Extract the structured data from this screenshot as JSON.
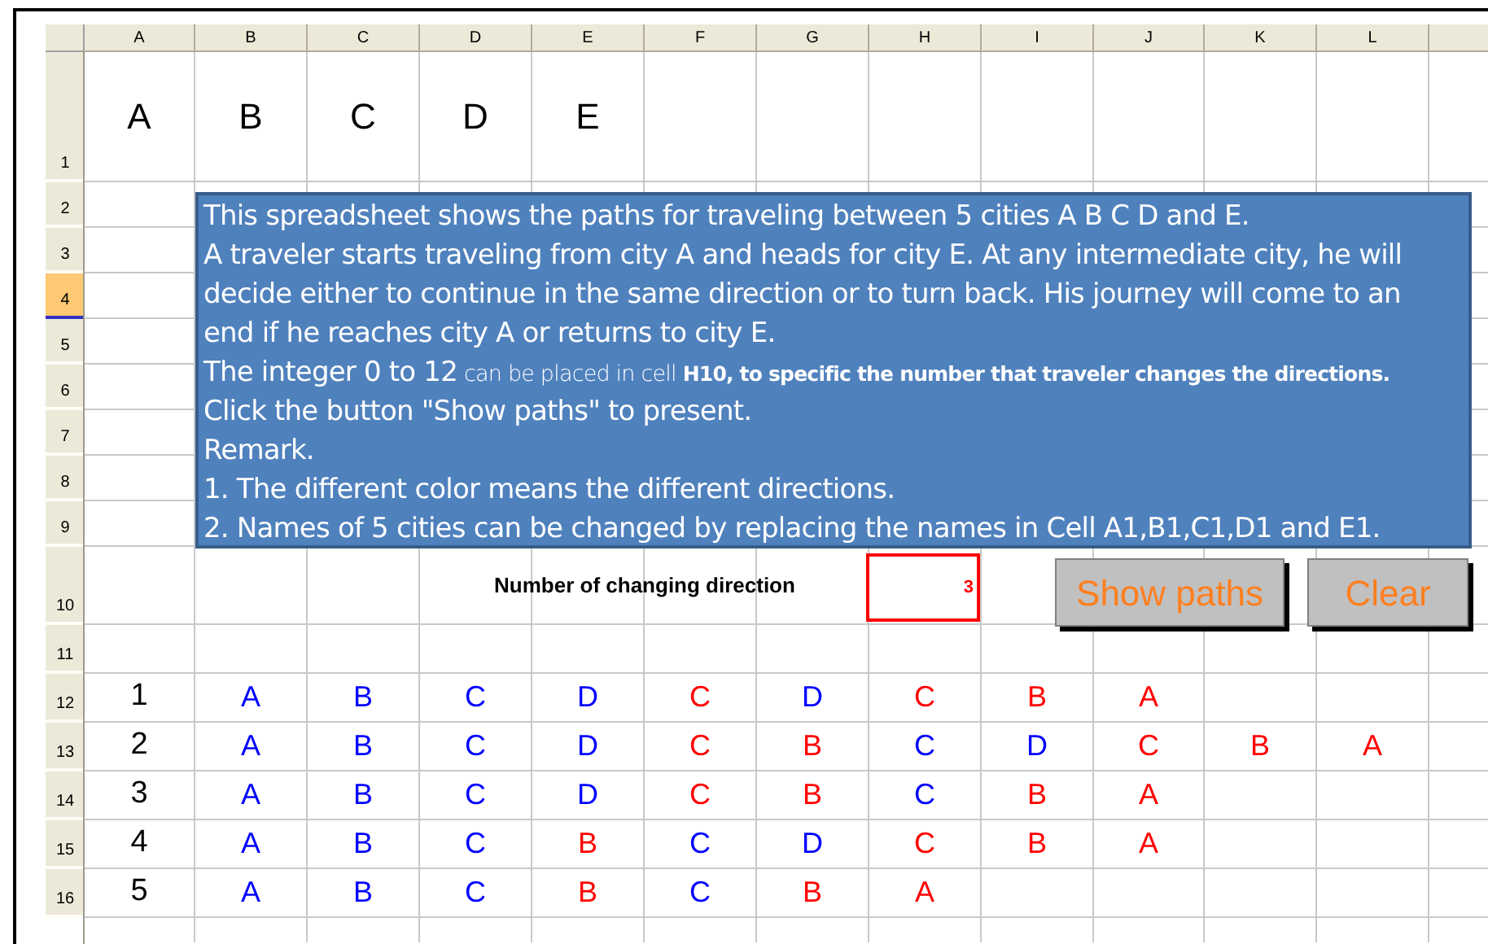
{
  "column_headers": [
    {
      "label": "A",
      "selected": false
    },
    {
      "label": "B",
      "selected": false
    },
    {
      "label": "C",
      "selected": false
    },
    {
      "label": "D",
      "selected": false
    },
    {
      "label": "E",
      "selected": false
    },
    {
      "label": "F",
      "selected": false
    },
    {
      "label": "G",
      "selected": false
    },
    {
      "label": "H",
      "selected": false
    },
    {
      "label": "I",
      "selected": false
    },
    {
      "label": "J",
      "selected": false
    },
    {
      "label": "K",
      "selected": false
    },
    {
      "label": "L",
      "selected": false
    }
  ],
  "row_headers": [
    {
      "label": "1",
      "selected": false
    },
    {
      "label": "2",
      "selected": false
    },
    {
      "label": "3",
      "selected": false
    },
    {
      "label": "4",
      "selected": true
    },
    {
      "label": "5",
      "selected": false
    },
    {
      "label": "6",
      "selected": false
    },
    {
      "label": "7",
      "selected": false
    },
    {
      "label": "8",
      "selected": false
    },
    {
      "label": "9",
      "selected": false
    },
    {
      "label": "10",
      "selected": false
    },
    {
      "label": "11",
      "selected": false
    },
    {
      "label": "12",
      "selected": false
    },
    {
      "label": "13",
      "selected": false
    },
    {
      "label": "14",
      "selected": false
    },
    {
      "label": "15",
      "selected": false
    },
    {
      "label": "16",
      "selected": false
    }
  ],
  "city_names": [
    "A",
    "B",
    "C",
    "D",
    "E"
  ],
  "note": {
    "lines": [
      {
        "parts": [
          {
            "text": "This spreadsheet shows the paths for traveling between 5 cities A B C D and E.",
            "kind": "main"
          }
        ]
      },
      {
        "parts": [
          {
            "text": "A traveler starts traveling from city A and heads for city E. At any intermediate city, he will",
            "kind": "main"
          }
        ]
      },
      {
        "parts": [
          {
            "text": "decide either to continue in the same direction or to turn back. His journey will come to an",
            "kind": "main"
          }
        ]
      },
      {
        "parts": [
          {
            "text": "end if he reaches city A or returns to city E.",
            "kind": "main"
          }
        ]
      },
      {
        "parts": [
          {
            "text": "The integer 0 to 12",
            "kind": "main"
          },
          {
            "text": "can be placed in cell",
            "kind": "fine"
          },
          {
            "text": "H10, to specific the number that traveler changes the directions.",
            "kind": "fine_bold"
          }
        ]
      },
      {
        "parts": [
          {
            "text": "Click the button \"Show paths\" to present.",
            "kind": "main"
          }
        ]
      },
      {
        "parts": [
          {
            "text": "Remark.",
            "kind": "main"
          }
        ]
      },
      {
        "parts": [
          {
            "text": "1. The different color means the different directions.",
            "kind": "main"
          }
        ]
      },
      {
        "parts": [
          {
            "text": "2. Names of 5 cities can be changed by replacing the names in Cell A1,B1,C1,D1 and E1.",
            "kind": "main"
          }
        ]
      }
    ]
  },
  "direction_field": {
    "label": "Number of changing direction",
    "value": "3"
  },
  "buttons": [
    {
      "label": "Show paths"
    },
    {
      "label": "Clear"
    }
  ],
  "paths": [
    {
      "number": "1",
      "stops": [
        {
          "city": "A",
          "color": "#0000ff"
        },
        {
          "city": "B",
          "color": "#0000ff"
        },
        {
          "city": "C",
          "color": "#0000ff"
        },
        {
          "city": "D",
          "color": "#0000ff"
        },
        {
          "city": "C",
          "color": "#ff0000"
        },
        {
          "city": "D",
          "color": "#0000ff"
        },
        {
          "city": "C",
          "color": "#ff0000"
        },
        {
          "city": "B",
          "color": "#ff0000"
        },
        {
          "city": "A",
          "color": "#ff0000"
        }
      ]
    },
    {
      "number": "2",
      "stops": [
        {
          "city": "A",
          "color": "#0000ff"
        },
        {
          "city": "B",
          "color": "#0000ff"
        },
        {
          "city": "C",
          "color": "#0000ff"
        },
        {
          "city": "D",
          "color": "#0000ff"
        },
        {
          "city": "C",
          "color": "#ff0000"
        },
        {
          "city": "B",
          "color": "#ff0000"
        },
        {
          "city": "C",
          "color": "#0000ff"
        },
        {
          "city": "D",
          "color": "#0000ff"
        },
        {
          "city": "C",
          "color": "#ff0000"
        },
        {
          "city": "B",
          "color": "#ff0000"
        },
        {
          "city": "A",
          "color": "#ff0000"
        }
      ]
    },
    {
      "number": "3",
      "stops": [
        {
          "city": "A",
          "color": "#0000ff"
        },
        {
          "city": "B",
          "color": "#0000ff"
        },
        {
          "city": "C",
          "color": "#0000ff"
        },
        {
          "city": "D",
          "color": "#0000ff"
        },
        {
          "city": "C",
          "color": "#ff0000"
        },
        {
          "city": "B",
          "color": "#ff0000"
        },
        {
          "city": "C",
          "color": "#0000ff"
        },
        {
          "city": "B",
          "color": "#ff0000"
        },
        {
          "city": "A",
          "color": "#ff0000"
        }
      ]
    },
    {
      "number": "4",
      "stops": [
        {
          "city": "A",
          "color": "#0000ff"
        },
        {
          "city": "B",
          "color": "#0000ff"
        },
        {
          "city": "C",
          "color": "#0000ff"
        },
        {
          "city": "B",
          "color": "#ff0000"
        },
        {
          "city": "C",
          "color": "#0000ff"
        },
        {
          "city": "D",
          "color": "#0000ff"
        },
        {
          "city": "C",
          "color": "#ff0000"
        },
        {
          "city": "B",
          "color": "#ff0000"
        },
        {
          "city": "A",
          "color": "#ff0000"
        }
      ]
    },
    {
      "number": "5",
      "stops": [
        {
          "city": "A",
          "color": "#0000ff"
        },
        {
          "city": "B",
          "color": "#0000ff"
        },
        {
          "city": "C",
          "color": "#0000ff"
        },
        {
          "city": "B",
          "color": "#ff0000"
        },
        {
          "city": "C",
          "color": "#0000ff"
        },
        {
          "city": "B",
          "color": "#ff0000"
        },
        {
          "city": "A",
          "color": "#ff0000"
        }
      ]
    }
  ]
}
